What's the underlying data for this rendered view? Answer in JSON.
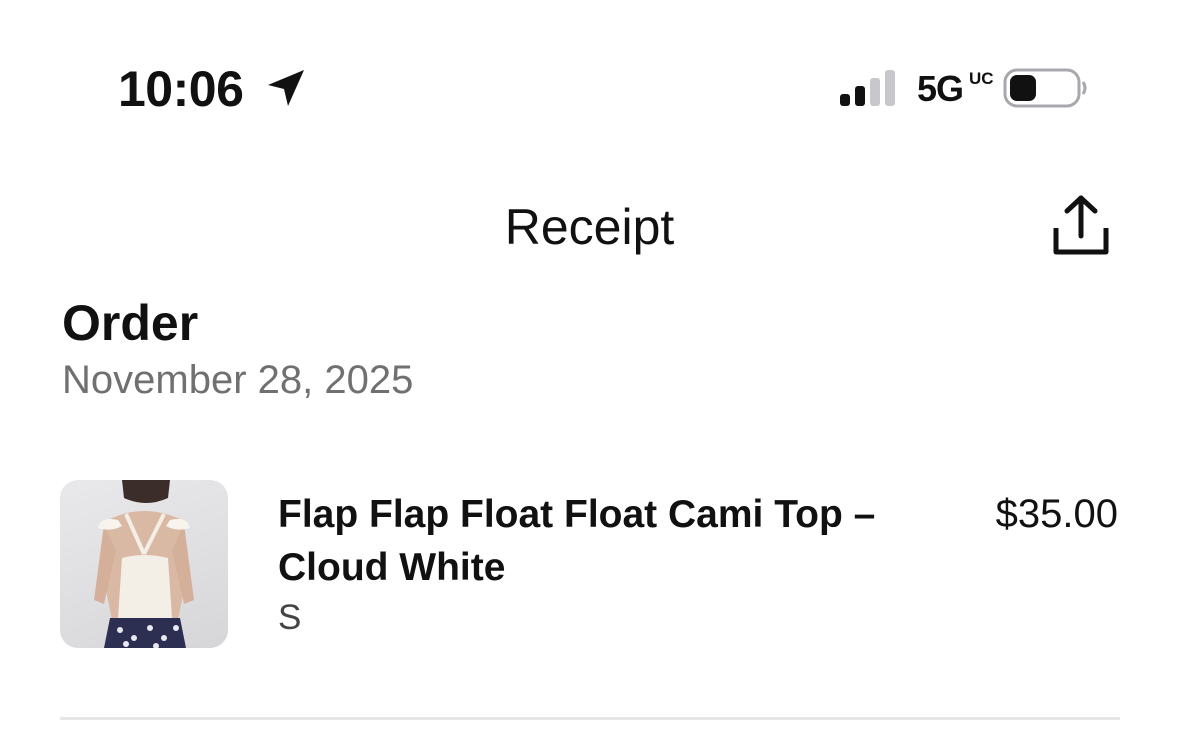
{
  "status_bar": {
    "time": "10:06",
    "network": "5G",
    "network_sub": "UC",
    "location_icon": "location-arrow-icon",
    "signal_icon": "cellular-signal-icon",
    "signal_bars_active": 2,
    "signal_bars_total": 4,
    "battery_icon": "battery-icon",
    "battery_level": 0.3
  },
  "nav": {
    "title": "Receipt",
    "share_icon": "share-icon"
  },
  "order": {
    "heading": "Order",
    "date": "November 28, 2025"
  },
  "items": [
    {
      "name": "Flap Flap Float Float Cami Top – Cloud White",
      "size": "S",
      "price": "$35.00",
      "image_icon": "product-photo"
    }
  ],
  "colors": {
    "text_primary": "#111111",
    "text_secondary": "#707070",
    "divider": "#e6e6e8",
    "background": "#ffffff"
  }
}
